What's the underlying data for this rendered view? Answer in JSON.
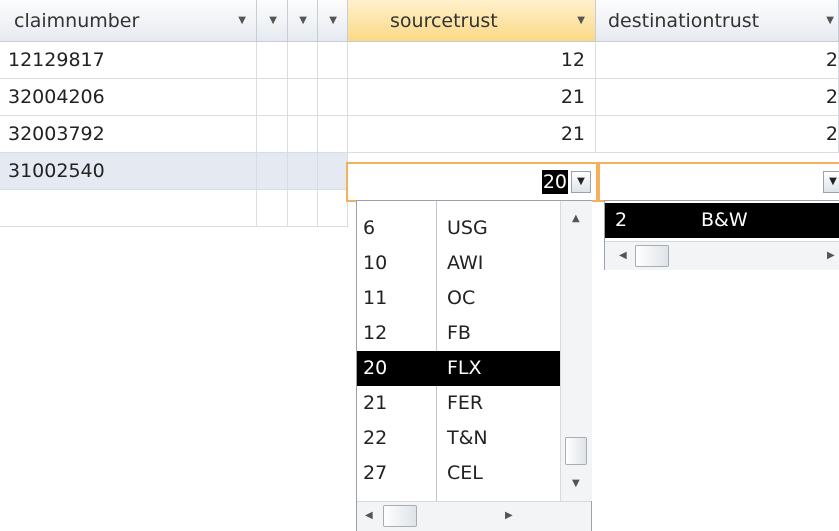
{
  "columns": {
    "claimnumber": "claimnumber",
    "sourcetrust": "sourcetrust",
    "destinationtrust": "destinationtrust"
  },
  "rows": [
    {
      "claimnumber": "12129817",
      "sourcetrust": "12",
      "destinationtrust": "2"
    },
    {
      "claimnumber": "32004206",
      "sourcetrust": "21",
      "destinationtrust": "2"
    },
    {
      "claimnumber": "32003792",
      "sourcetrust": "21",
      "destinationtrust": "2"
    },
    {
      "claimnumber": "31002540",
      "sourcetrust": "20",
      "destinationtrust": ""
    }
  ],
  "source_dropdown": {
    "items": [
      {
        "id": "6",
        "name": "USG"
      },
      {
        "id": "10",
        "name": "AWI"
      },
      {
        "id": "11",
        "name": "OC"
      },
      {
        "id": "12",
        "name": "FB"
      },
      {
        "id": "20",
        "name": "FLX"
      },
      {
        "id": "21",
        "name": "FER"
      },
      {
        "id": "22",
        "name": "T&N"
      },
      {
        "id": "27",
        "name": "CEL"
      }
    ],
    "highlighted_id": "20"
  },
  "destination_dropdown": {
    "items": [
      {
        "id": "2",
        "name": "B&W"
      }
    ]
  },
  "icons": {
    "dropdown_arrow": "chevron-down-icon",
    "header_menu": "column-menu-icon",
    "scroll_up": "scroll-up-icon",
    "scroll_down": "scroll-down-icon",
    "scroll_left": "scroll-left-icon",
    "scroll_right": "scroll-right-icon"
  },
  "colors": {
    "selected_header": "#fbd986",
    "active_row": "#e5eaf2",
    "edit_border": "#f3b15e",
    "highlight": "#000000"
  }
}
